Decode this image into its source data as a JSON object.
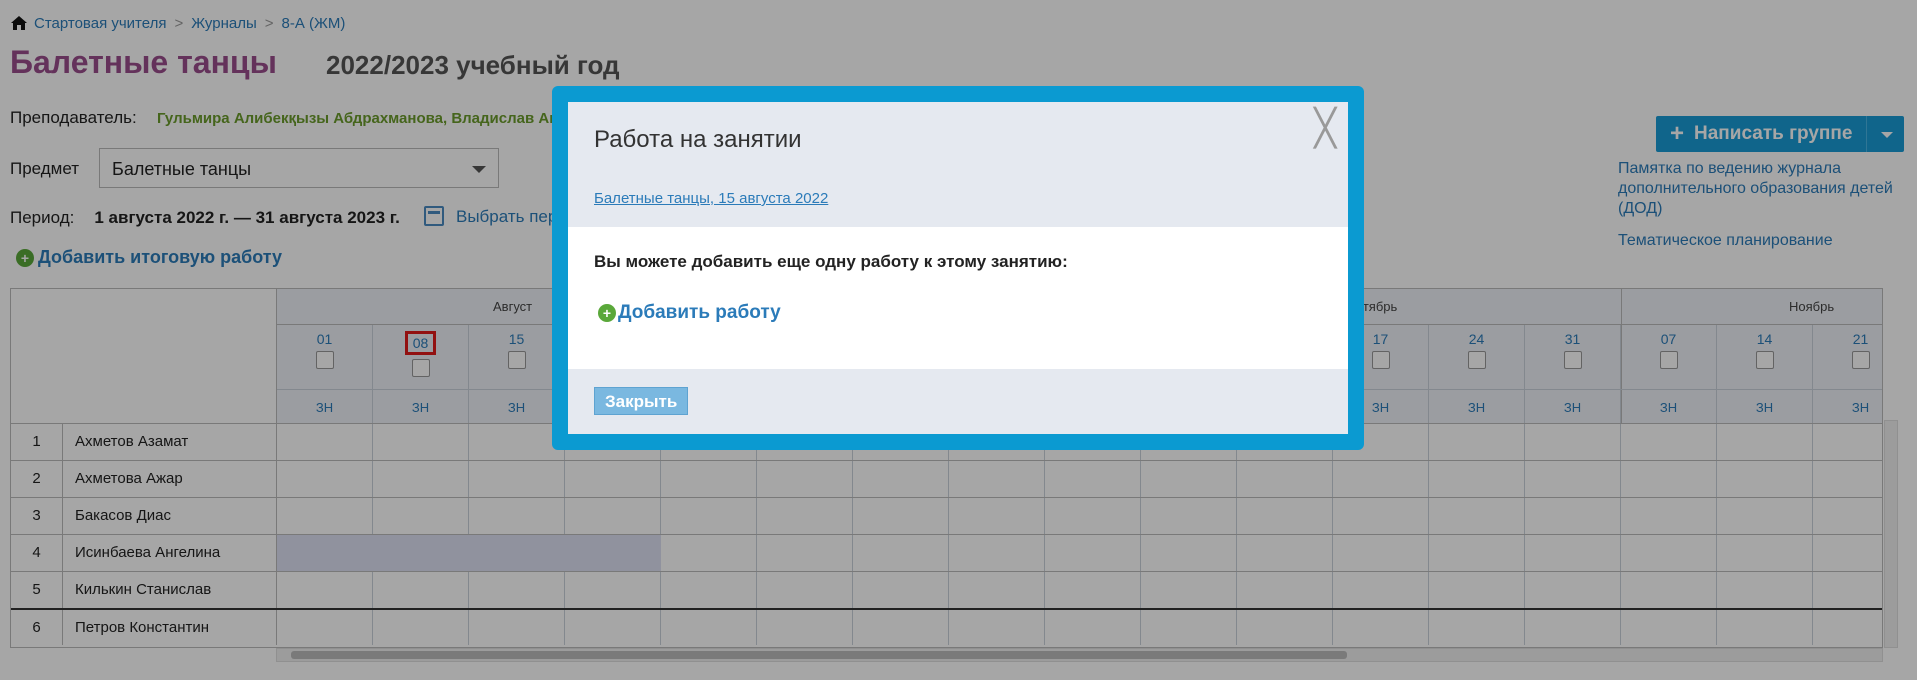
{
  "breadcrumb": [
    "Стартовая учителя",
    "Журналы",
    "8-А (ЖМ)"
  ],
  "breadcrumb_sep": ">",
  "page": {
    "title": "Балетные танцы",
    "year": "2022/2023 учебный год",
    "teacher_label": "Преподаватель:",
    "teacher_names": "Гульмира Алибекқызы Абдрахманова, Владислав Ан",
    "subject_label": "Предмет",
    "subject_value": "Балетные танцы",
    "period_label": "Период:",
    "period_value": "1 августа 2022 г. — 31 августа 2023 г.",
    "choose_period": "Выбрать пер",
    "add_final": "Добавить итоговую работу"
  },
  "right_panel": {
    "write_group": "Написать группе",
    "links": [
      "Памятка по ведению журнала дополнительного образования детей (ДОД)",
      "Тематическое планирование"
    ]
  },
  "journal": {
    "months": [
      "Август",
      "ктябрь",
      "Ноябрь"
    ],
    "columns_left": [
      "01",
      "08",
      "15"
    ],
    "columns_right": [
      "17",
      "24",
      "31",
      "07",
      "14",
      "21"
    ],
    "lesson_type": "ЗН",
    "students": [
      {
        "num": "1",
        "name": "Ахметов Азамат"
      },
      {
        "num": "2",
        "name": "Ахметова Ажар"
      },
      {
        "num": "3",
        "name": "Бакасов Диас"
      },
      {
        "num": "4",
        "name": "Исинбаева Ангелина"
      },
      {
        "num": "5",
        "name": "Килькин Станислав"
      },
      {
        "num": "6",
        "name": "Петров Константин"
      }
    ]
  },
  "modal": {
    "title": "Работа на занятии",
    "close": "╳",
    "subtitle": "Балетные танцы, 15 августа 2022",
    "text": "Вы можете добавить еще одну работу к этому занятию:",
    "add_work": "Добавить работу",
    "close_button": "Закрыть"
  },
  "colors": {
    "accent": "#0b9ad1",
    "title": "#9a4e8c",
    "link": "#2b7bb9",
    "teacher": "#6b9b2b"
  }
}
